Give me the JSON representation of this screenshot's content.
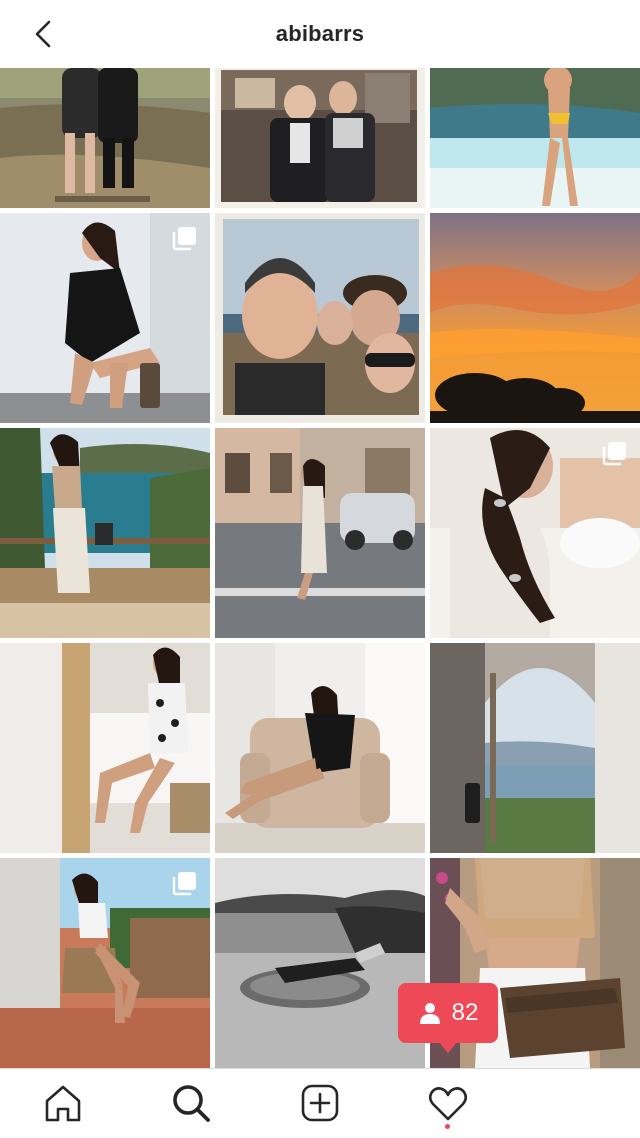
{
  "header": {
    "title": "abibarrs"
  },
  "icons": {
    "back": "chevron-left-icon",
    "multi_post": "carousel-icon",
    "person": "person-icon",
    "home": "home-icon",
    "search": "search-icon",
    "new_post": "plus-square-icon",
    "activity": "heart-icon",
    "profile": "avatar"
  },
  "grid": {
    "posts": [
      {
        "name": "post-couple-swing",
        "multi": false
      },
      {
        "name": "post-group-restaurant",
        "multi": false
      },
      {
        "name": "post-pool-bikini",
        "multi": false
      },
      {
        "name": "post-black-dress-crouching",
        "multi": true
      },
      {
        "name": "post-polaroid-friends",
        "multi": false
      },
      {
        "name": "post-orange-sunset",
        "multi": false
      },
      {
        "name": "post-cliff-balcony",
        "multi": false
      },
      {
        "name": "post-street-white-dress",
        "multi": false
      },
      {
        "name": "post-braided-hair",
        "multi": true
      },
      {
        "name": "post-mirror-selfie",
        "multi": false
      },
      {
        "name": "post-armchair-black-dress",
        "multi": false
      },
      {
        "name": "post-arched-window-sea",
        "multi": false
      },
      {
        "name": "post-terrace-chair",
        "multi": true
      },
      {
        "name": "post-bw-inflatable",
        "multi": false
      },
      {
        "name": "post-louis-clutch",
        "multi": false
      }
    ]
  },
  "notification": {
    "count": "82"
  },
  "colors": {
    "accent_red": "#ed4956",
    "text_primary": "#262626",
    "border": "#dbdbdb"
  }
}
